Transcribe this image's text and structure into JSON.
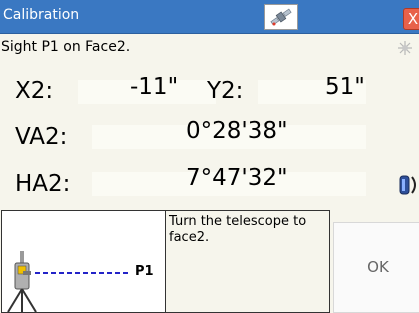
{
  "window": {
    "title": "Calibration",
    "title_icon": "satellite-icon",
    "close_label": "X"
  },
  "instruction": "Sight P1 on Face2.",
  "measurements": {
    "x2_label": "X2:",
    "x2_value": "-11\"",
    "y2_label": "Y2:",
    "y2_value": "51\"",
    "va2_label": "VA2:",
    "va2_value": "0°28'38\"",
    "ha2_label": "HA2:",
    "ha2_value": "7°47'32\""
  },
  "diagram": {
    "target_label": "P1",
    "instrument_icon": "total-station-icon"
  },
  "message": "Turn the telescope to face2.",
  "ok_label": "OK",
  "status_icons": {
    "top": "sun-icon",
    "bottom": "battery-icon"
  },
  "colors": {
    "titlebar": "#3a78c2",
    "background": "#f6f5ec",
    "close_button": "#e8614a",
    "diagram_line": "#2323c8"
  }
}
